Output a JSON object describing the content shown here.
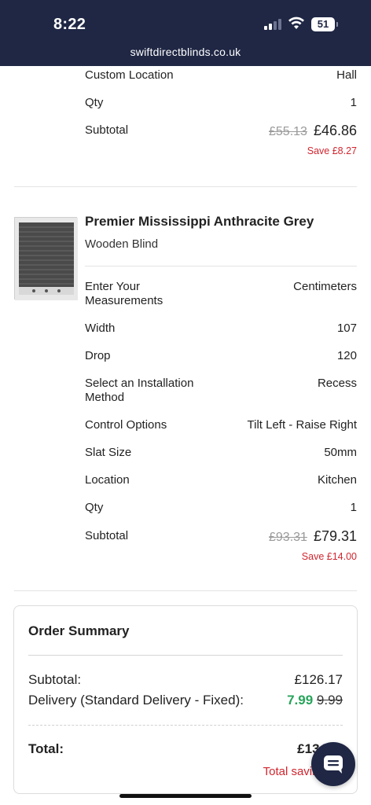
{
  "status_bar": {
    "time": "8:22",
    "battery": "51",
    "url": "swiftdirectblinds.co.uk"
  },
  "item1": {
    "rows": [
      {
        "label": "Custom Location",
        "value": "Hall"
      },
      {
        "label": "Qty",
        "value": "1"
      }
    ],
    "subtotal_label": "Subtotal",
    "old_price": "£55.13",
    "new_price": "£46.86",
    "save": "Save £8.27"
  },
  "item2": {
    "title": "Premier Mississippi Anthracite Grey",
    "subtitle": "Wooden Blind",
    "rows": [
      {
        "label": "Enter Your Measurements",
        "value": "Centimeters"
      },
      {
        "label": "Width",
        "value": "107"
      },
      {
        "label": "Drop",
        "value": "120"
      },
      {
        "label": "Select an Installation Method",
        "value": "Recess"
      },
      {
        "label": "Control Options",
        "value": "Tilt Left - Raise Right"
      },
      {
        "label": "Slat Size",
        "value": "50mm"
      },
      {
        "label": "Location",
        "value": "Kitchen"
      },
      {
        "label": "Qty",
        "value": "1"
      }
    ],
    "subtotal_label": "Subtotal",
    "old_price": "£93.31",
    "new_price": "£79.31",
    "save": "Save £14.00"
  },
  "summary": {
    "title": "Order Summary",
    "subtotal_label": "Subtotal:",
    "subtotal_value": "£126.17",
    "delivery_label": "Delivery (Standard Delivery - Fixed):",
    "delivery_new": "7.99",
    "delivery_old": "9.99",
    "total_label": "Total:",
    "total_value": "£134",
    "total_savings": "Total savings: £"
  },
  "icons": {
    "chat": "chat-bubble-icon",
    "wifi": "wifi-icon",
    "signal": "signal-icon",
    "battery": "battery-icon"
  },
  "colors": {
    "header_bg": "#1f2744",
    "save_red": "#d0262f",
    "delivery_green": "#27a45a"
  }
}
